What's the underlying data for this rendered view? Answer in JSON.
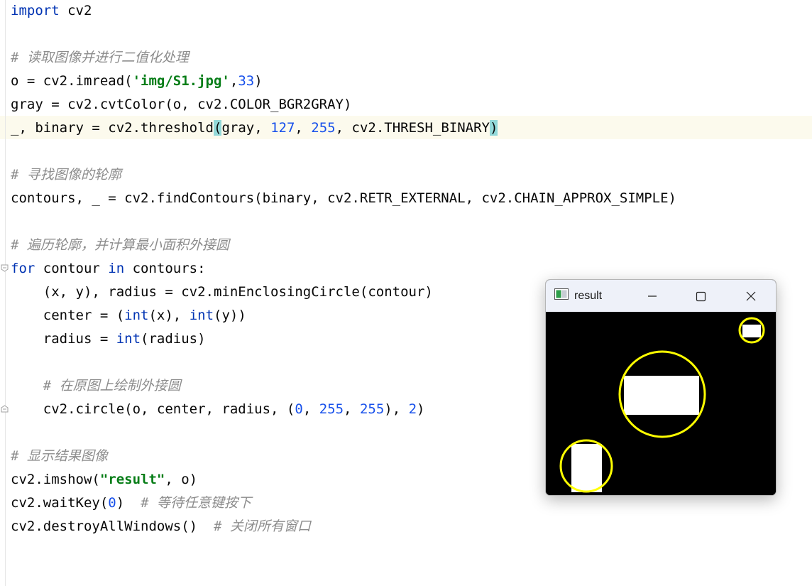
{
  "code": {
    "lines": [
      [
        {
          "t": "import",
          "c": "k"
        },
        {
          "t": " cv2"
        }
      ],
      [],
      [
        {
          "t": "# 读取图像并进行二值化处理",
          "c": "c"
        }
      ],
      [
        {
          "t": "o = cv2.imread("
        },
        {
          "t": "'img/S1.jpg'",
          "c": "s"
        },
        {
          "t": ","
        },
        {
          "t": "33",
          "c": "n"
        },
        {
          "t": ")"
        }
      ],
      [
        {
          "t": "gray = cv2.cvtColor(o, cv2.COLOR_BGR2GRAY)"
        }
      ],
      [
        {
          "t": "_, binary = cv2.threshold"
        },
        {
          "t": "(",
          "c": "bracket"
        },
        {
          "t": "gray, "
        },
        {
          "t": "127",
          "c": "n"
        },
        {
          "t": ", "
        },
        {
          "t": "255",
          "c": "n"
        },
        {
          "t": ", cv2.THRESH_BINARY"
        },
        {
          "t": ")",
          "c": "bracket"
        }
      ],
      [],
      [
        {
          "t": "# 寻找图像的轮廓",
          "c": "c"
        }
      ],
      [
        {
          "t": "contours, _ = cv2.findContours(binary, cv2.RETR_EXTERNAL, cv2.CHAIN_APPROX_SIMPLE)"
        }
      ],
      [],
      [
        {
          "t": "# 遍历轮廓，并计算最小面积外接圆",
          "c": "c"
        }
      ],
      [
        {
          "t": "for",
          "c": "k"
        },
        {
          "t": " contour "
        },
        {
          "t": "in",
          "c": "k"
        },
        {
          "t": " contours:"
        }
      ],
      [
        {
          "t": "    (x, y), radius = cv2.minEnclosingCircle(contour)"
        }
      ],
      [
        {
          "t": "    center = ("
        },
        {
          "t": "int",
          "c": "k"
        },
        {
          "t": "(x), "
        },
        {
          "t": "int",
          "c": "k"
        },
        {
          "t": "(y))"
        }
      ],
      [
        {
          "t": "    radius = "
        },
        {
          "t": "int",
          "c": "k"
        },
        {
          "t": "(radius)"
        }
      ],
      [],
      [
        {
          "t": "    # 在原图上绘制外接圆",
          "c": "c"
        }
      ],
      [
        {
          "t": "    cv2.circle(o, center, radius, ("
        },
        {
          "t": "0",
          "c": "n"
        },
        {
          "t": ", "
        },
        {
          "t": "255",
          "c": "n"
        },
        {
          "t": ", "
        },
        {
          "t": "255",
          "c": "n"
        },
        {
          "t": "), "
        },
        {
          "t": "2",
          "c": "n"
        },
        {
          "t": ")"
        }
      ],
      [],
      [
        {
          "t": "# 显示结果图像",
          "c": "c"
        }
      ],
      [
        {
          "t": "cv2.imshow("
        },
        {
          "t": "\"result\"",
          "c": "s"
        },
        {
          "t": ", o)"
        }
      ],
      [
        {
          "t": "cv2.waitKey("
        },
        {
          "t": "0",
          "c": "n"
        },
        {
          "t": ")  "
        },
        {
          "t": "# 等待任意键按下",
          "c": "c"
        }
      ],
      [
        {
          "t": "cv2.destroyAllWindows()  "
        },
        {
          "t": "# 关闭所有窗口",
          "c": "c"
        }
      ]
    ]
  },
  "window": {
    "title": "result",
    "icons": {
      "app": "image-window-icon",
      "minimize": "minimize-icon",
      "maximize": "maximize-icon",
      "close": "close-icon"
    },
    "colors": {
      "background": "#000000",
      "shape": "#ffffff",
      "circle": "#ffff00"
    }
  }
}
